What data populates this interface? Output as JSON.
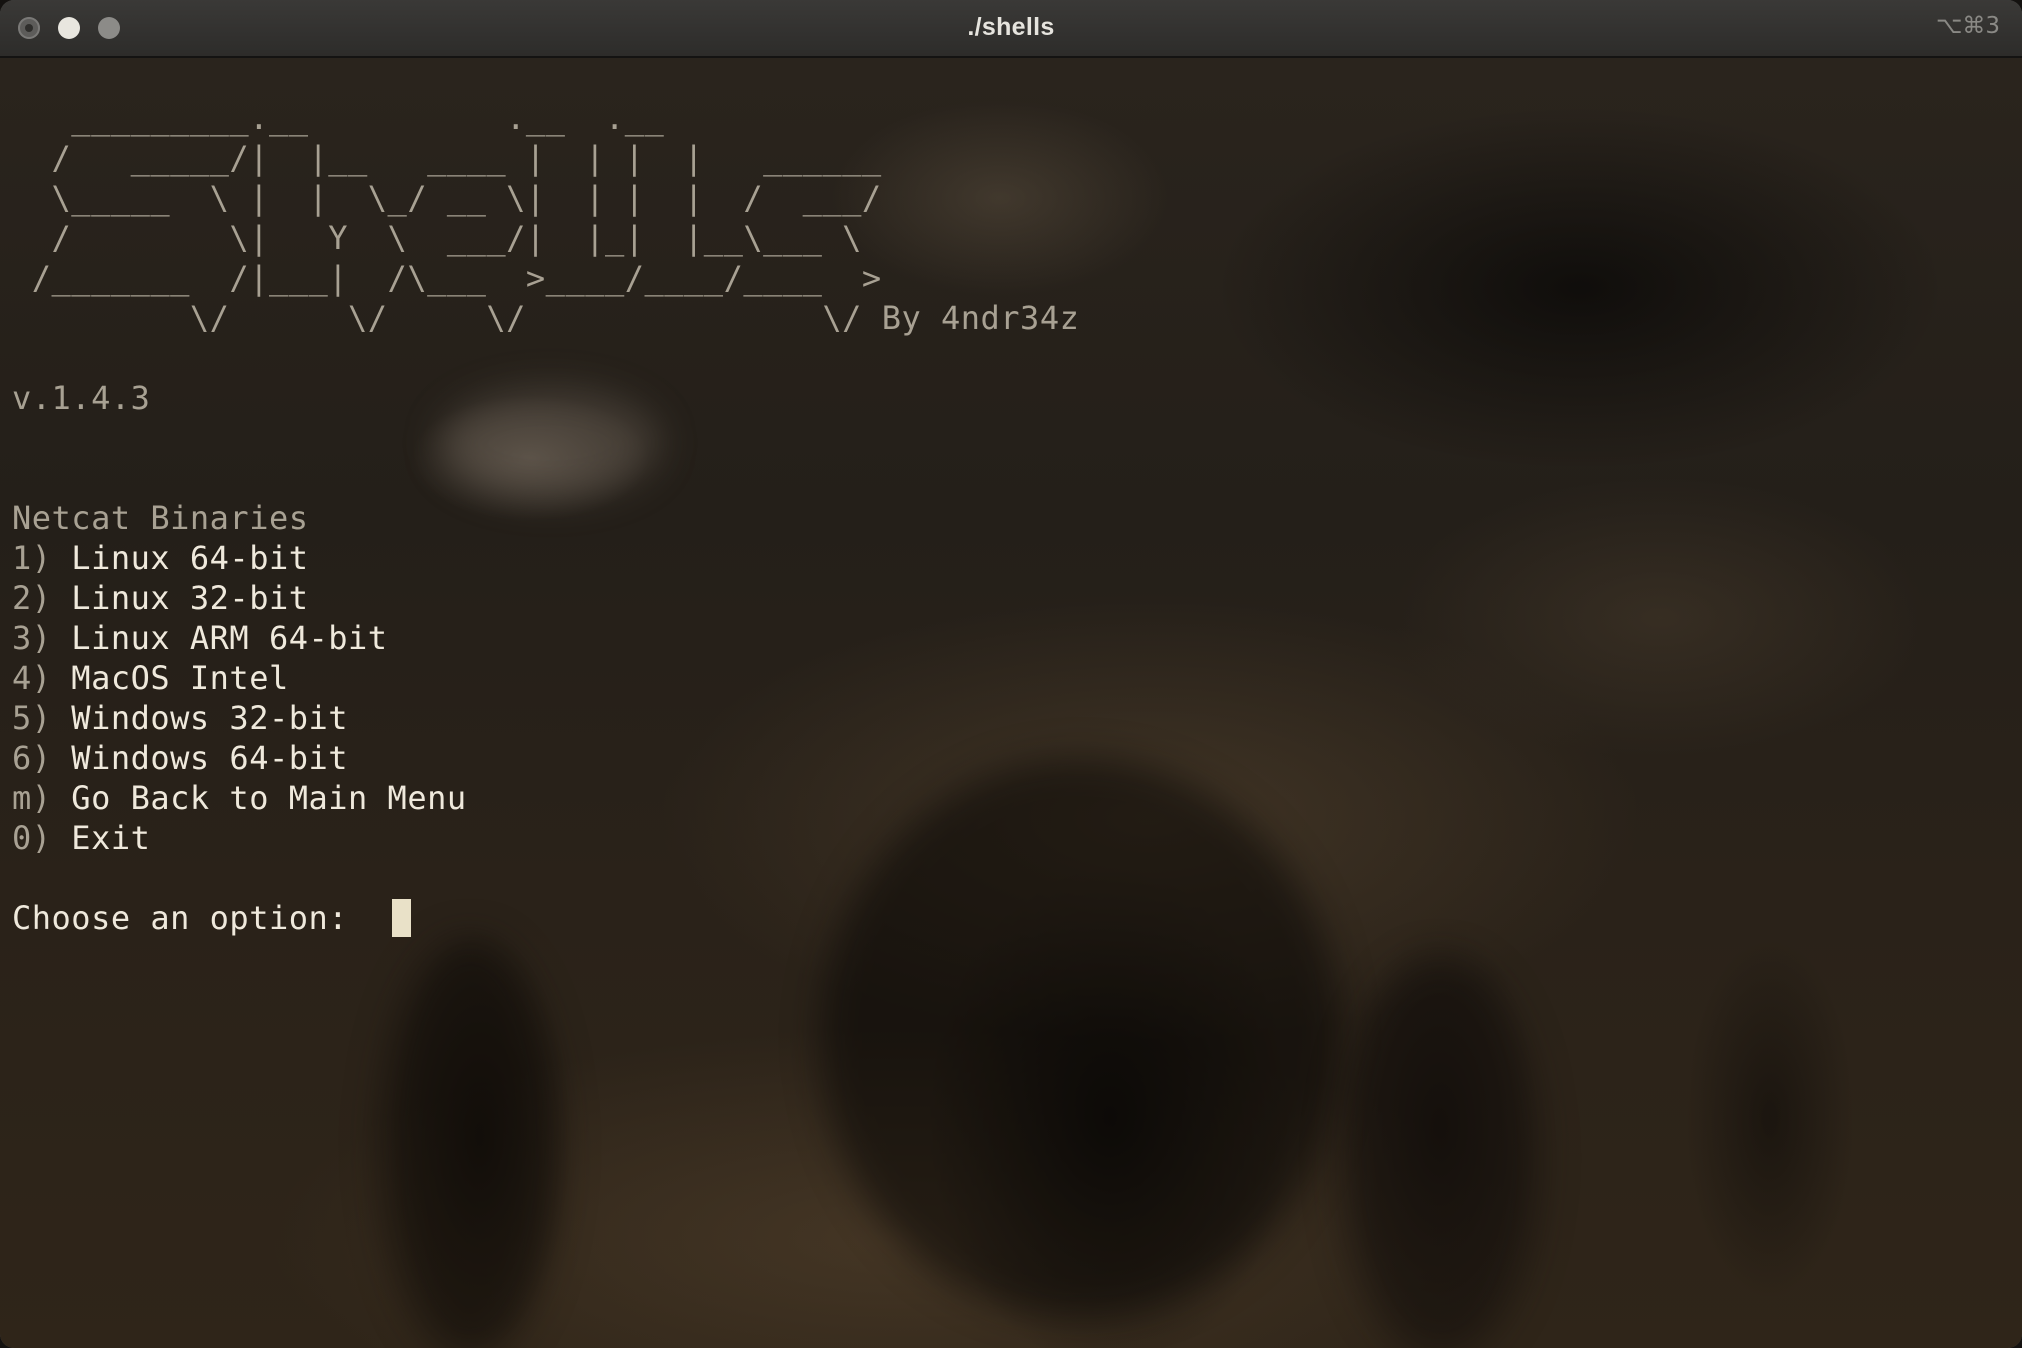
{
  "window": {
    "title": "./shells",
    "shortcut": "⌥⌘3"
  },
  "terminal": {
    "banner_lines": [
      "   _________.__          .__  .__",
      "  /   _____/|  |__   ____ |  | |  |   ______",
      "  \\_____  \\ |  |  \\_/ __ \\|  | |  |  /  ___/",
      "  /        \\|   Y  \\  ___/|  |_|  |__\\___ \\",
      " /_______  /|___|  /\\___  >____/____/____  >",
      "         \\/      \\/     \\/               \\/ By 4ndr34z"
    ],
    "version": "v.1.4.3",
    "menu_heading": "Netcat Binaries",
    "menu_items": [
      {
        "key": "1)",
        "label": "Linux 64-bit"
      },
      {
        "key": "2)",
        "label": "Linux 32-bit"
      },
      {
        "key": "3)",
        "label": "Linux ARM 64-bit"
      },
      {
        "key": "4)",
        "label": "MacOS Intel"
      },
      {
        "key": "5)",
        "label": "Windows 32-bit"
      },
      {
        "key": "6)",
        "label": "Windows 64-bit"
      },
      {
        "key": "m)",
        "label": "Go Back to Main Menu"
      },
      {
        "key": "0)",
        "label": "Exit"
      }
    ],
    "prompt": "Choose an option:  ",
    "input_value": ""
  },
  "colors": {
    "text_bright": "#efe9dc",
    "text_muted": "#a8a193",
    "cursor": "#e9e1c8",
    "titlebar": "#2f2e2c"
  }
}
